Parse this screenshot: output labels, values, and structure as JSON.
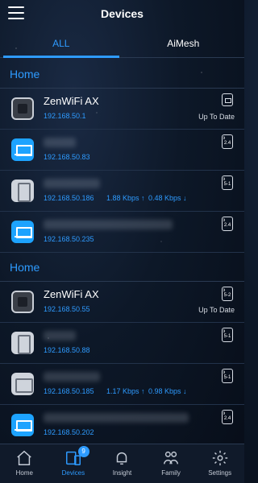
{
  "header": {
    "title": "Devices"
  },
  "tabs": [
    {
      "label": "ALL"
    },
    {
      "label": "AiMesh"
    }
  ],
  "groups": [
    {
      "label": "Home",
      "devices": [
        {
          "name": "ZenWiFi AX",
          "ip": "192.168.50.1",
          "status": "Up To Date",
          "icon": "router-icon",
          "badge": "link-icon"
        },
        {
          "name": "",
          "ip": "192.168.50.83",
          "icon": "laptop-icon",
          "band": "2.4"
        },
        {
          "name": "",
          "ip": "192.168.50.186",
          "speed_up": "1.88 Kbps ↑",
          "speed_down": "0.48 Kbps ↓",
          "icon": "phone-icon",
          "band": "5-1"
        },
        {
          "name": "",
          "ip": "192.168.50.235",
          "icon": "laptop-icon",
          "band": "2.4"
        }
      ]
    },
    {
      "label": "Home",
      "devices": [
        {
          "name": "ZenWiFi AX",
          "ip": "192.168.50.55",
          "status": "Up To Date",
          "icon": "router-icon",
          "band": "5-2"
        },
        {
          "name": "",
          "ip": "192.168.50.88",
          "icon": "phone-icon",
          "band": "5-1"
        },
        {
          "name": "",
          "ip": "192.168.50.185",
          "speed_up": "1.17 Kbps ↑",
          "speed_down": "0.98 Kbps ↓",
          "icon": "tablet-icon",
          "band": "5-1"
        },
        {
          "name": "",
          "ip": "192.168.50.202",
          "icon": "laptop-icon",
          "band": "2.4"
        }
      ]
    }
  ],
  "nav": {
    "items": [
      {
        "label": "Home",
        "icon": "home-icon"
      },
      {
        "label": "Devices",
        "icon": "devices-icon",
        "badge": "9"
      },
      {
        "label": "Insight",
        "icon": "bell-icon"
      },
      {
        "label": "Family",
        "icon": "family-icon"
      },
      {
        "label": "Settings",
        "icon": "gear-icon"
      }
    ]
  },
  "colors": {
    "accent": "#2e9bff",
    "background": "#0d1828",
    "laptop": "#1da3ff"
  }
}
